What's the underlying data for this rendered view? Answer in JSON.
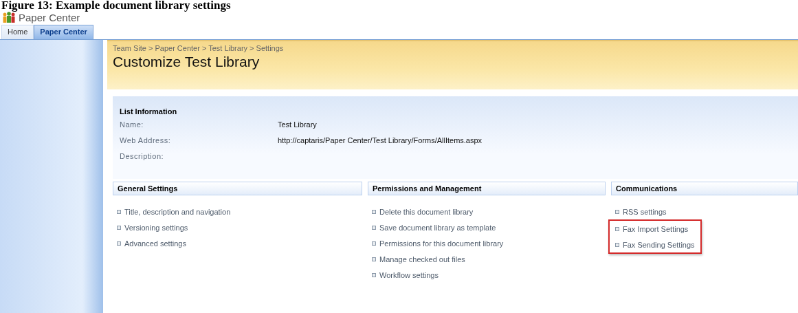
{
  "caption": "Figure 13: Example document library settings",
  "site": {
    "title": "Paper Center"
  },
  "tabs": [
    {
      "label": "Home",
      "selected": false
    },
    {
      "label": "Paper Center",
      "selected": true
    }
  ],
  "breadcrumb": "Team Site > Paper Center > Test Library > Settings",
  "page_title": "Customize Test Library",
  "list_information": {
    "heading": "List Information",
    "fields": [
      {
        "label": "Name:",
        "value": "Test Library"
      },
      {
        "label": "Web Address:",
        "value": "http://captaris/Paper Center/Test Library/Forms/AllItems.aspx"
      },
      {
        "label": "Description:"
      }
    ]
  },
  "sections": [
    {
      "heading": "General Settings",
      "links": [
        {
          "label": "Title, description and navigation",
          "highlighted": false
        },
        {
          "label": "Versioning settings",
          "highlighted": false
        },
        {
          "label": "Advanced settings",
          "highlighted": false
        }
      ]
    },
    {
      "heading": "Permissions and Management",
      "links": [
        {
          "label": "Delete this document library",
          "highlighted": false
        },
        {
          "label": "Save document library as template",
          "highlighted": false
        },
        {
          "label": "Permissions for this document library",
          "highlighted": false
        },
        {
          "label": "Manage checked out files",
          "highlighted": false
        },
        {
          "label": "Workflow settings",
          "highlighted": false
        }
      ]
    },
    {
      "heading": "Communications",
      "links": [
        {
          "label": "RSS settings",
          "highlighted": false
        },
        {
          "label": "Fax Import Settings",
          "highlighted": true
        },
        {
          "label": "Fax Sending Settings",
          "highlighted": true
        }
      ]
    }
  ]
}
